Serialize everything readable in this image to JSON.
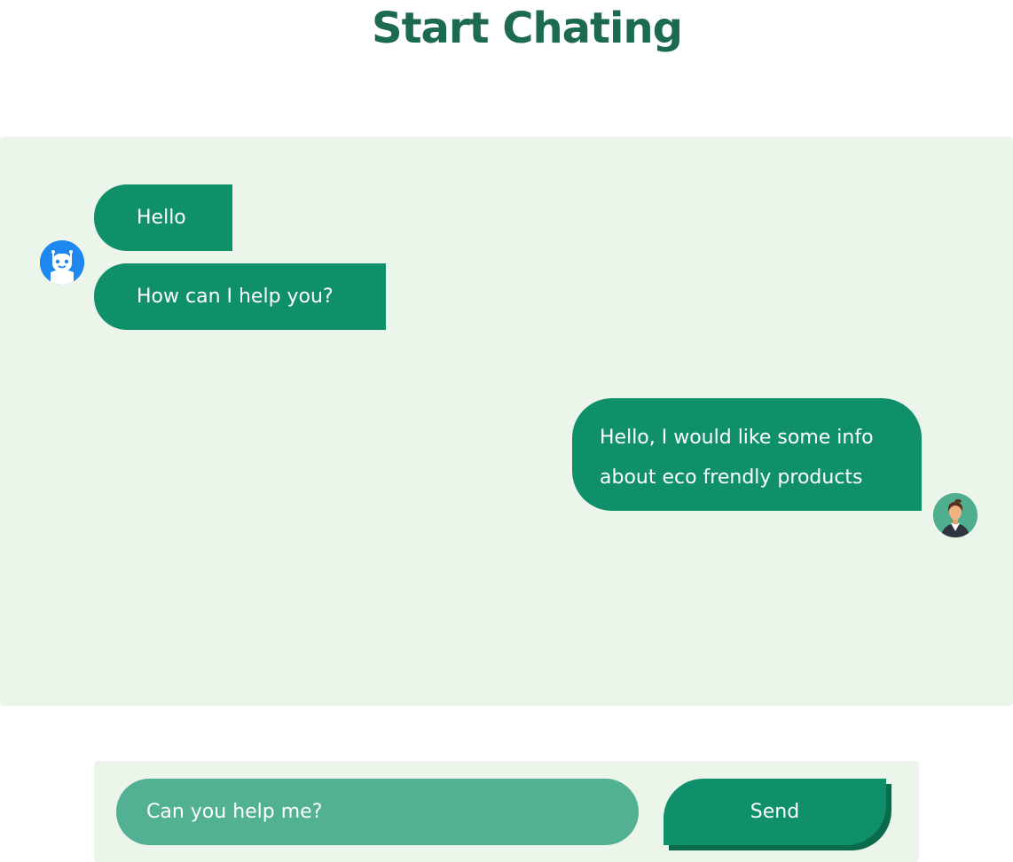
{
  "header": {
    "title": "Start Chating"
  },
  "chat": {
    "bot_messages": [
      "Hello",
      "How can I help you?"
    ],
    "user_messages": [
      "Hello, I would like some info\nabout eco frendly products"
    ],
    "bot_avatar_icon": "robot-icon",
    "user_avatar_icon": "businesswoman-icon"
  },
  "composer": {
    "placeholder": "Can you help me?",
    "send_label": "Send"
  },
  "colors": {
    "title": "#1c6b4e",
    "panel_background": "#ebf5ea",
    "bubble": "#0f906b",
    "input": "#52b093",
    "bot_avatar": "#1e88f0",
    "user_avatar": "#4fae8e"
  }
}
